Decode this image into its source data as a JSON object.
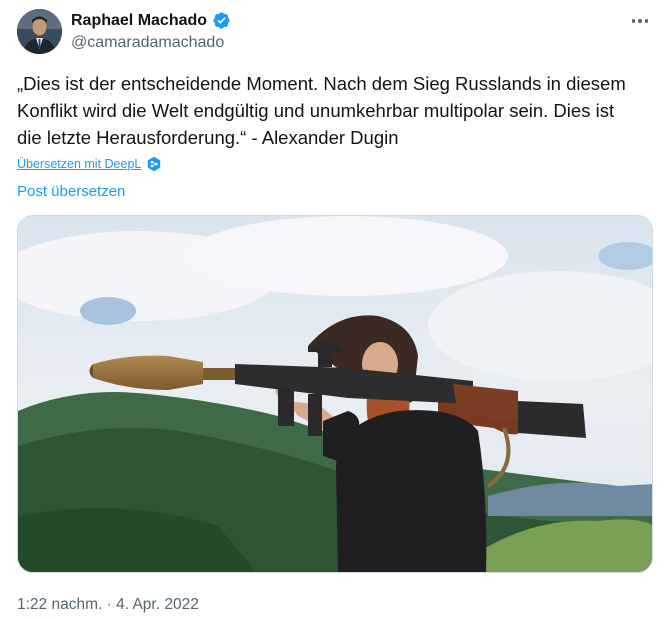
{
  "author": {
    "display_name": "Raphael Machado",
    "handle": "@camaradamachado",
    "verified": true
  },
  "tweet": {
    "text": "„Dies ist der entscheidende Moment. Nach dem Sieg Russlands in diesem Konflikt wird die Welt endgültig und unumkehrbar multipolar sein. Dies ist die letzte Herausforderung.“ - Alexander Dugin",
    "deepl_link": "Übersetzen mit DeepL",
    "translate_link": "Post übersetzen",
    "timestamp": "1:22 nachm. · 4. Apr. 2022"
  },
  "icons": {
    "verified": "verified-badge-icon",
    "more": "more-options-icon",
    "deepl": "deepl-icon"
  },
  "colors": {
    "accent": "#1d9bf0",
    "secondary_text": "#536471",
    "primary_text": "#0f1419"
  }
}
